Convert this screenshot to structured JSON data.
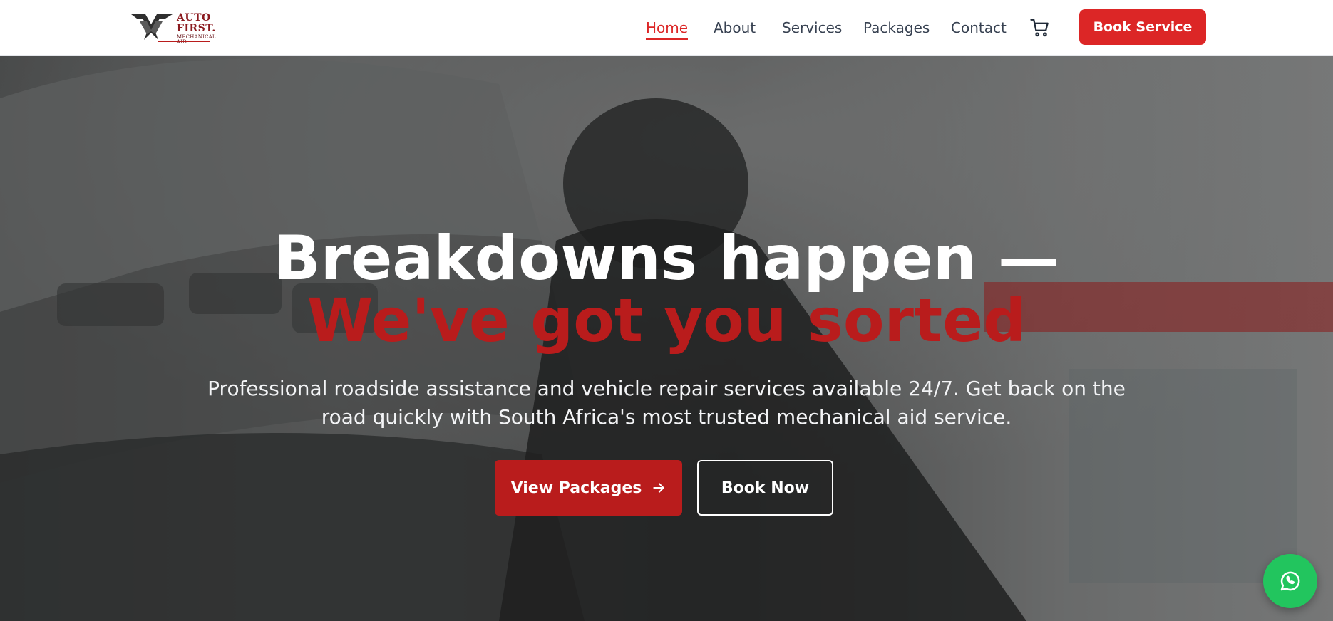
{
  "brand": {
    "logo_line1": "AUTO",
    "logo_line2": "FIRST.",
    "logo_line3": "MECHANICAL AID",
    "color_primary": "#dc2626",
    "color_dark_red": "#b91c1c"
  },
  "nav": {
    "items": [
      {
        "label": "Home",
        "active": true
      },
      {
        "label": "About",
        "active": false
      },
      {
        "label": "Services",
        "active": false
      },
      {
        "label": "Packages",
        "active": false
      },
      {
        "label": "Contact",
        "active": false
      }
    ],
    "cart_icon": "shopping-cart-icon",
    "cta_label": "Book Service"
  },
  "hero": {
    "headline_line1": "Breakdowns happen —",
    "headline_line2": "We've got you sorted",
    "subtitle": "Professional roadside assistance and vehicle repair services available 24/7. Get back on the road quickly with South Africa's most trusted mechanical aid service.",
    "primary_button": "View Packages",
    "primary_button_icon": "arrow-right-icon",
    "secondary_button": "Book Now"
  },
  "floating": {
    "whatsapp_icon": "whatsapp-icon",
    "color": "#22c55e"
  }
}
